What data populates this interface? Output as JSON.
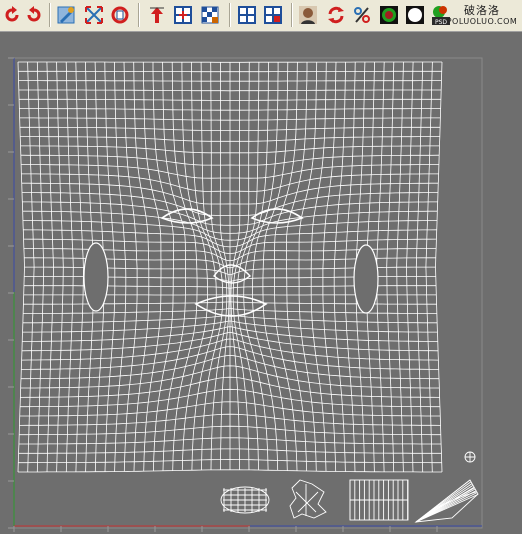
{
  "toolbar": {
    "buttons": [
      {
        "name": "undo-icon",
        "color": "#d01f1f"
      },
      {
        "name": "redo-icon",
        "color": "#d01f1f"
      },
      {
        "name": "paint-brush-icon",
        "color": "#2a6fb4"
      },
      {
        "name": "scatter-arrows-icon",
        "color": "#2a6fb4"
      },
      {
        "name": "relax-uv-icon",
        "color": "#d01f1f"
      },
      {
        "name": "move-up-icon",
        "color": "#d01f1f"
      },
      {
        "name": "layout-grid-icon",
        "color": "#2a6fb4"
      },
      {
        "name": "checker-grid-icon",
        "color": "#cc6600"
      },
      {
        "name": "quad-select-icon",
        "color": "#1f4f9a"
      },
      {
        "name": "quad-select-red-icon",
        "color": "#d01f1f"
      },
      {
        "name": "face-portrait-icon",
        "color": "#333333"
      },
      {
        "name": "rotate-arrows-icon",
        "color": "#d01f1f"
      },
      {
        "name": "percent-tool-icon",
        "color": "#2a6fb4"
      },
      {
        "name": "rgb-swatch-icon",
        "color": "#20a020"
      },
      {
        "name": "white-circle-icon",
        "color": "#ffffff"
      },
      {
        "name": "snapshot-icon",
        "color": "#cc3300"
      }
    ],
    "snapshot_badge": "PSD"
  },
  "watermark": {
    "site_name": "破洛洛",
    "site_url": "POLUOLUO.COM"
  },
  "viewport": {
    "background_color": "#6e6e6e",
    "wire_color": "#ffffff",
    "x_axis_color": "#c83232",
    "y_axis_color": "#2e9a2e"
  }
}
